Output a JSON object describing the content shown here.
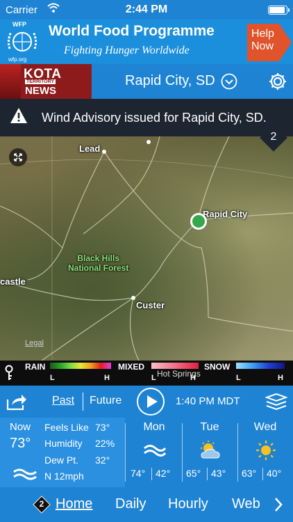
{
  "status_bar": {
    "carrier": "Carrier",
    "time": "2:44 PM"
  },
  "ad": {
    "logo_top": "WFP",
    "logo_bottom": "wfp.org",
    "title": "World Food Programme",
    "subtitle": "Fighting Hunger Worldwide",
    "cta_line1": "Help",
    "cta_line2": "Now",
    "cta_color": "#e0532b"
  },
  "header": {
    "brand_name": "KOTA",
    "brand_territory": "TERRITORY",
    "brand_news": "NEWS",
    "city": "Rapid City, SD"
  },
  "alert": {
    "message": "Wind Advisory issued for Rapid City, SD.",
    "count": "2"
  },
  "map": {
    "labels": {
      "lead": "Lead",
      "rapid_city": "Rapid City",
      "forest_line1": "Black Hills",
      "forest_line2": "National Forest",
      "castle": "castle",
      "custer": "Custer",
      "hot_springs": "Hot Springs"
    },
    "legal": "Legal"
  },
  "legend": {
    "rain": "RAIN",
    "mixed": "MIXED",
    "snow": "SNOW",
    "low": "L",
    "high": "H"
  },
  "controls": {
    "past": "Past",
    "future": "Future",
    "timestamp": "1:40 PM MDT"
  },
  "current": {
    "label": "Now",
    "temp": "73°",
    "feels_like_label": "Feels Like",
    "feels_like": "73°",
    "humidity_label": "Humidity",
    "humidity": "22%",
    "dew_point_label": "Dew Pt.",
    "dew_point": "32°",
    "wind": "N 12mph"
  },
  "days": [
    {
      "name": "Mon",
      "hi": "74°",
      "lo": "42°",
      "icon": "wind-icon"
    },
    {
      "name": "Tue",
      "hi": "65°",
      "lo": "43°",
      "icon": "partly-cloudy-icon"
    },
    {
      "name": "Wed",
      "hi": "63°",
      "lo": "40°",
      "icon": "sun-icon"
    }
  ],
  "nav": {
    "badge": "2",
    "home": "Home",
    "daily": "Daily",
    "hourly": "Hourly",
    "web": "Web"
  }
}
